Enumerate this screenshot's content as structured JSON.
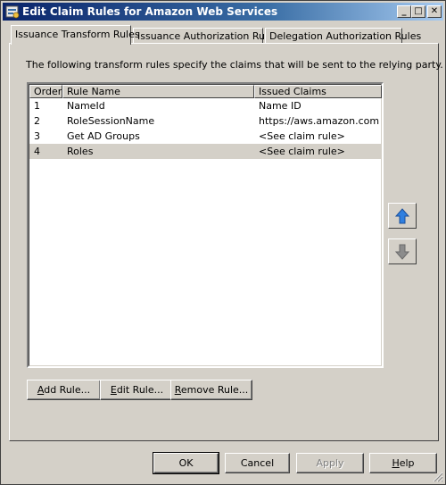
{
  "window": {
    "title": "Edit Claim Rules for Amazon Web Services",
    "controls": {
      "minimize": "_",
      "maximize": "□",
      "close": "✕"
    }
  },
  "tabs": [
    {
      "label": "Issuance Transform Rules",
      "active": true
    },
    {
      "label": "Issuance Authorization Rules",
      "active": false
    },
    {
      "label": "Delegation Authorization Rules",
      "active": false
    }
  ],
  "panel": {
    "description": "The following transform rules specify the claims that will be sent to the relying party."
  },
  "rules_table": {
    "columns": [
      "Order",
      "Rule Name",
      "Issued Claims"
    ],
    "rows": [
      {
        "order": "1",
        "name": "NameId",
        "claims": "Name ID",
        "selected": false
      },
      {
        "order": "2",
        "name": "RoleSessionName",
        "claims": "https://aws.amazon.com...",
        "selected": false
      },
      {
        "order": "3",
        "name": "Get AD Groups",
        "claims": "<See claim rule>",
        "selected": false
      },
      {
        "order": "4",
        "name": "Roles",
        "claims": "<See claim rule>",
        "selected": true
      }
    ]
  },
  "rule_actions": {
    "add_accel": "A",
    "add_rest": "dd Rule...",
    "edit_accel": "E",
    "edit_rest": "dit Rule...",
    "remove_accel": "R",
    "remove_rest": "emove Rule..."
  },
  "move_buttons": {
    "up_icon": "arrow-up-icon",
    "down_icon": "arrow-down-icon",
    "up_color": "#2f7fe0",
    "down_color": "#8c8c8c"
  },
  "dialog_buttons": {
    "ok": "OK",
    "cancel": "Cancel",
    "apply": "Apply",
    "help_accel": "H",
    "help_rest": "elp"
  }
}
